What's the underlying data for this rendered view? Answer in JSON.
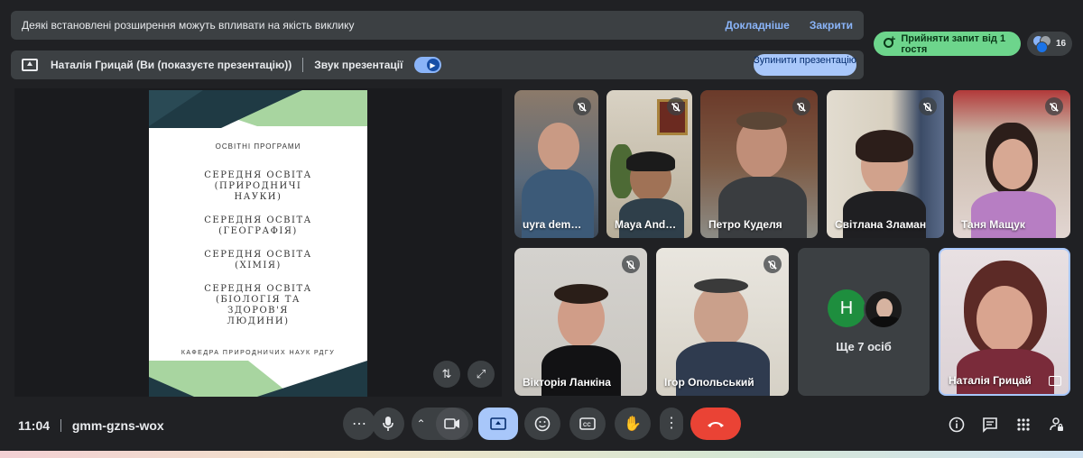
{
  "banner": {
    "message": "Деякі встановлені розширення можуть впливати на якість виклику",
    "details_link": "Докладніше",
    "close_link": "Закрити"
  },
  "presenting_bar": {
    "presenter": "Наталія Грицай (Ви (показуєте презентацію))",
    "sound_label": "Звук презентації",
    "sound_on": true,
    "stop_button": "Зупинити презентацію"
  },
  "top_right": {
    "accept_button": "Прийняти запит від 1 гостя",
    "participant_count": "16"
  },
  "slide": {
    "label": "ОСВІТНІ ПРОГРАМИ",
    "programs": [
      "СЕРЕДНЯ ОСВІТА (ПРИРОДНИЧІ НАУКИ)",
      "СЕРЕДНЯ ОСВІТА (ГЕОГРАФІЯ)",
      "СЕРЕДНЯ ОСВІТА (ХІМІЯ)",
      "СЕРЕДНЯ ОСВІТА (БІОЛОГІЯ ТА ЗДОРОВ'Я ЛЮДИНИ)"
    ],
    "department": "КАФЕДРА ПРИРОДНИЧИХ НАУК РДГУ",
    "colors": {
      "navy": "#1f3a44",
      "green": "#a8d5a0"
    }
  },
  "participants": [
    {
      "name": "uyra dem…",
      "muted": true
    },
    {
      "name": "Maya And…",
      "muted": true
    },
    {
      "name": "Петро Куделя",
      "muted": true
    },
    {
      "name": "Світлана Зламан",
      "muted": true
    },
    {
      "name": "Таня Мащук",
      "muted": true
    },
    {
      "name": "Вікторія Ланкіна",
      "muted": true
    },
    {
      "name": "Ігор Опольський",
      "muted": true
    }
  ],
  "more_tile": {
    "avatar_letter": "Н",
    "label": "Ще 7 осіб"
  },
  "self_tile": {
    "name": "Наталія Грицай"
  },
  "meeting": {
    "time": "11:04",
    "code": "gmm-gzns-wox"
  },
  "colors": {
    "background": "#202124",
    "accent": "#8ab4f8",
    "end_call": "#ea4335",
    "accept_green": "#6dd58c"
  }
}
